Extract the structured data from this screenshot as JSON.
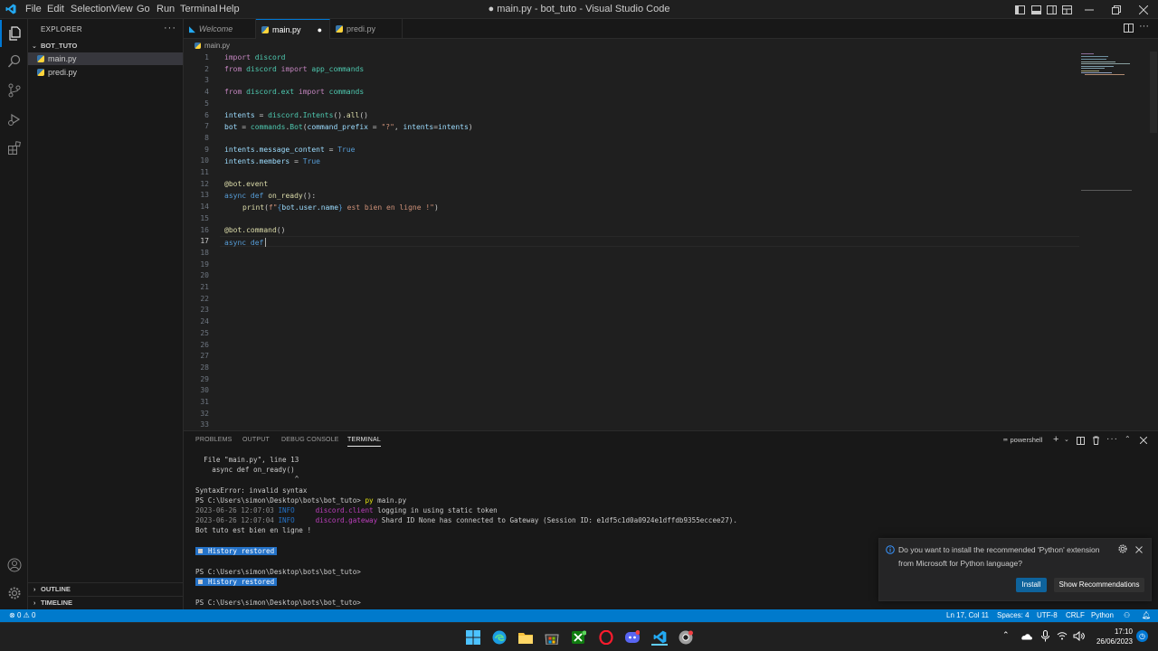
{
  "window": {
    "title": "● main.py - bot_tuto - Visual Studio Code"
  },
  "menu": [
    "File",
    "Edit",
    "Selection",
    "View",
    "Go",
    "Run",
    "Terminal",
    "Help"
  ],
  "explorer": {
    "header": "EXPLORER",
    "folder": "BOT_TUTO",
    "files": [
      "main.py",
      "predi.py"
    ],
    "outline": "OUTLINE",
    "timeline": "TIMELINE"
  },
  "tabs": [
    {
      "label": "Welcome"
    },
    {
      "label": "main.py",
      "modified": "●"
    },
    {
      "label": "predi.py"
    }
  ],
  "breadcrumb": "main.py",
  "line_numbers": [
    "1",
    "2",
    "3",
    "4",
    "5",
    "6",
    "7",
    "8",
    "9",
    "10",
    "11",
    "12",
    "13",
    "14",
    "15",
    "16",
    "17",
    "18",
    "19",
    "20",
    "21",
    "22",
    "23",
    "24",
    "25",
    "26",
    "27",
    "28",
    "29",
    "30",
    "31",
    "32",
    "33"
  ],
  "code": {
    "l1": {
      "kw": "import",
      "mod": "discord"
    },
    "l2": {
      "kw1": "from",
      "mod": "discord",
      "kw2": "import",
      "name": "app_commands"
    },
    "l4": {
      "kw1": "from",
      "mod": "discord.ext",
      "kw2": "import",
      "name": "commands"
    },
    "l6": {
      "var": "intents",
      "op": " = ",
      "a": "discord",
      "b": ".",
      "cls": "Intents",
      "c": "().",
      "fn": "all",
      "d": "()"
    },
    "l7": {
      "var": "bot",
      "op": " = ",
      "a": "commands",
      "b": ".",
      "cls": "Bot",
      "c": "(",
      "p": "command_prefix",
      "eq": " = ",
      "str": "\"?\"",
      "comma": ", ",
      "p2": "intents",
      "eq2": "=",
      "v2": "intents",
      "e": ")"
    },
    "l9": {
      "var": "intents",
      "attr": ".message_content",
      "op": " = ",
      "val": "True"
    },
    "l10": {
      "var": "intents",
      "attr": ".members",
      "op": " = ",
      "val": "True"
    },
    "l12": {
      "dec": "@bot.event"
    },
    "l13": {
      "kw1": "async",
      "kw2": " def ",
      "fn": "on_ready",
      "rest": "():"
    },
    "l14": {
      "fn": "print",
      "a": "(",
      "s1": "f\"",
      "b": "{",
      "v": "bot.user.name",
      "c": "}",
      "s2": " est bien en ligne !\"",
      "d": ")"
    },
    "l16": {
      "dec": "@bot.command",
      "rest": "()"
    },
    "l17": {
      "kw1": "async",
      "kw2": " def"
    }
  },
  "panel": {
    "tabs": [
      "PROBLEMS",
      "OUTPUT",
      "DEBUG CONSOLE",
      "TERMINAL"
    ],
    "shell": "powershell"
  },
  "terminal": {
    "t1": "  File \"main.py\", line 13",
    "t2": "    async def on_ready()",
    "t3": "                        ^",
    "t4": "SyntaxError: invalid syntax",
    "t5_prompt": "PS C:\\Users\\simon\\Desktop\\bots\\bot_tuto> ",
    "t5_cmd": "py",
    "t5_arg": " main.py",
    "t6_date": "2023-06-26 12:07:03 ",
    "t6_level": "INFO    ",
    "t6_src": " discord.client",
    "t6_msg": " logging in using static token",
    "t7_date": "2023-06-26 12:07:04 ",
    "t7_level": "INFO    ",
    "t7_src": " discord.gateway",
    "t7_msg": " Shard ID None has connected to Gateway (Session ID: e1df5c1d0a0924e1dffdb9355eccee27).",
    "t8": "Bot tuto est bien en ligne !",
    "history": "History restored",
    "prompt": "PS C:\\Users\\simon\\Desktop\\bots\\bot_tuto>"
  },
  "notification": {
    "line1": "Do you want to install the recommended 'Python' extension",
    "line2": "from Microsoft for Python language?",
    "install": "Install",
    "show": "Show Recommendations"
  },
  "status": {
    "errors": "0",
    "warnings": "0",
    "position": "Ln 17, Col 11",
    "spaces": "Spaces: 4",
    "encoding": "UTF-8",
    "eol": "CRLF",
    "language": "Python"
  },
  "taskbar": {
    "time": "17:10",
    "date": "26/06/2023"
  },
  "colors": {
    "accent": "#007acc",
    "tab_active_border": "#0078d4",
    "install_button": "#0e639c"
  }
}
